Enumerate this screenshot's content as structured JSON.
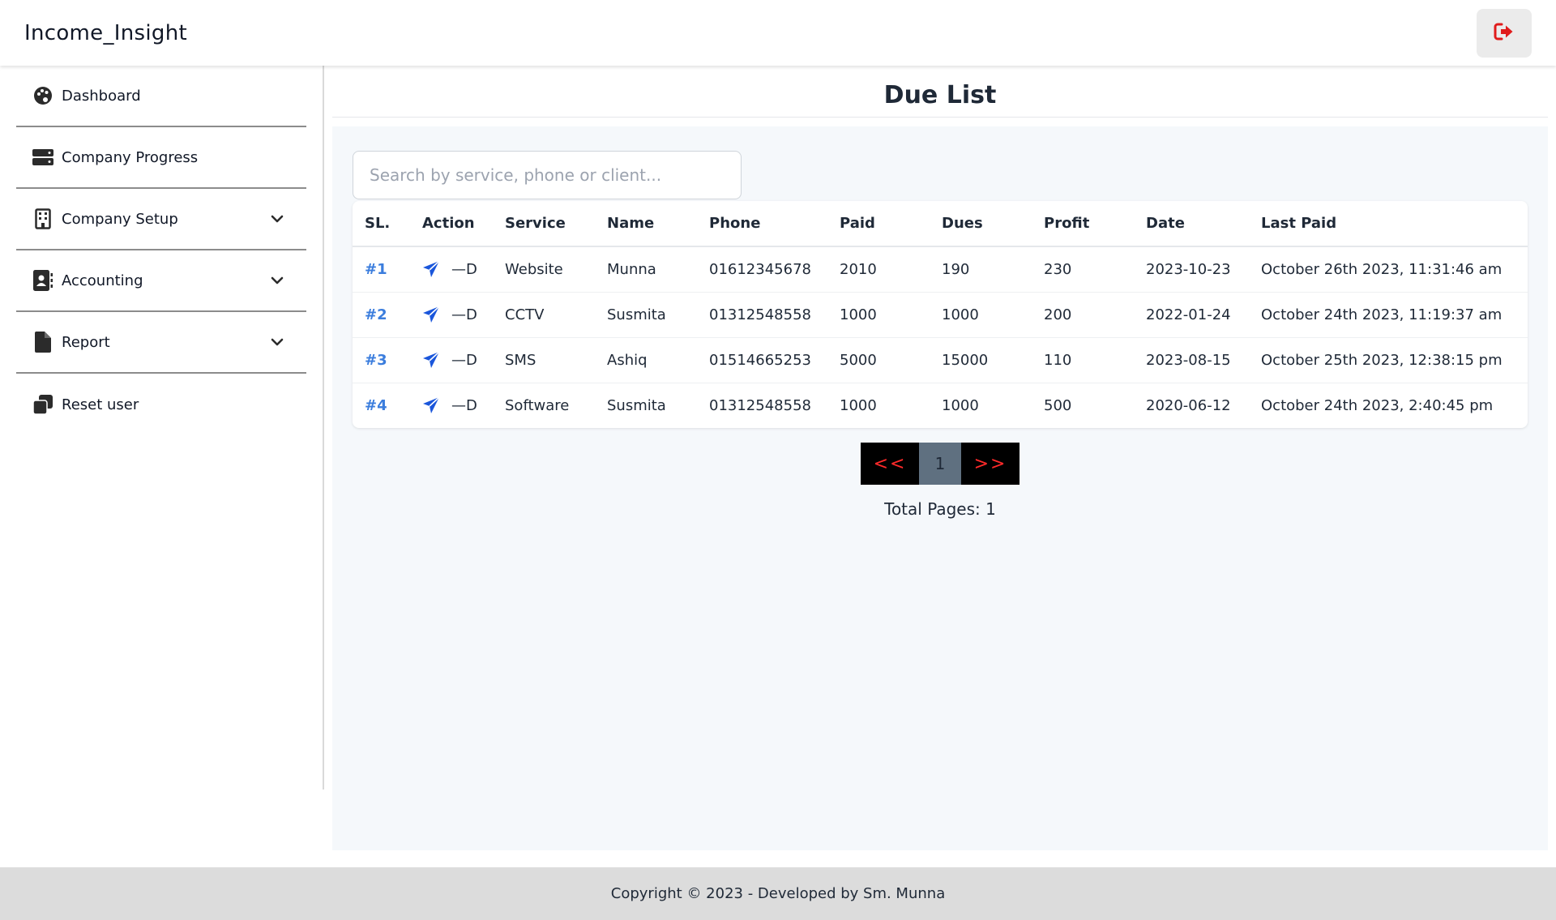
{
  "app": {
    "title": "Income_Insight"
  },
  "header": {
    "logout_icon": "sign-out-icon",
    "logout_color": "#e01b1b"
  },
  "sidebar": {
    "items": [
      {
        "label": "Dashboard",
        "icon": "palette-icon",
        "expandable": false
      },
      {
        "label": "Company Progress",
        "icon": "server-icon",
        "expandable": false
      },
      {
        "label": "Company Setup",
        "icon": "building-icon",
        "expandable": true
      },
      {
        "label": "Accounting",
        "icon": "contact-book-icon",
        "expandable": true
      },
      {
        "label": "Report",
        "icon": "file-icon",
        "expandable": true
      },
      {
        "label": "Reset user",
        "icon": "copy-icon",
        "expandable": false
      }
    ]
  },
  "main": {
    "title": "Due List",
    "search": {
      "placeholder": "Search by service, phone or client...",
      "value": ""
    },
    "table": {
      "columns": [
        "SL.",
        "Action",
        "Service",
        "Name",
        "Phone",
        "Paid",
        "Dues",
        "Profit",
        "Date",
        "Last Paid"
      ],
      "rows": [
        {
          "sl": "#1",
          "action_label": "—D",
          "service": "Website",
          "name": "Munna",
          "phone": "01612345678",
          "paid": "2010",
          "dues": "190",
          "profit": "230",
          "date": "2023-10-23",
          "last_paid": "October 26th 2023, 11:31:46 am"
        },
        {
          "sl": "#2",
          "action_label": "—D",
          "service": "CCTV",
          "name": "Susmita",
          "phone": "01312548558",
          "paid": "1000",
          "dues": "1000",
          "profit": "200",
          "date": "2022-01-24",
          "last_paid": "October 24th 2023, 11:19:37 am"
        },
        {
          "sl": "#3",
          "action_label": "—D",
          "service": "SMS",
          "name": "Ashiq",
          "phone": "01514665253",
          "paid": "5000",
          "dues": "15000",
          "profit": "110",
          "date": "2023-08-15",
          "last_paid": "October 25th 2023, 12:38:15 pm"
        },
        {
          "sl": "#4",
          "action_label": "—D",
          "service": "Software",
          "name": "Susmita",
          "phone": "01312548558",
          "paid": "1000",
          "dues": "1000",
          "profit": "500",
          "date": "2020-06-12",
          "last_paid": "October 24th 2023, 2:40:45 pm"
        }
      ]
    },
    "pagination": {
      "prev": "<<",
      "current": "1",
      "next": ">>",
      "total_label": "Total Pages: 1"
    }
  },
  "footer": {
    "text": "Copyright © 2023 - Developed by Sm. Munna"
  },
  "colors": {
    "link": "#3b7ddd",
    "send_icon": "#1a56db",
    "pager_bg": "#000000",
    "pager_arrow": "#ff2a2a",
    "pager_current_bg": "#5f7080",
    "footer_bg": "#dcdcdc",
    "panel_bg": "#f5f8fb"
  }
}
